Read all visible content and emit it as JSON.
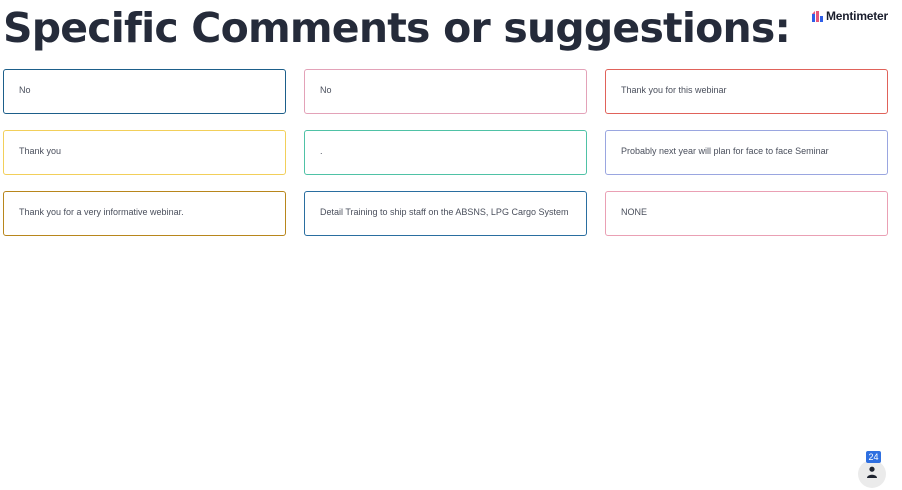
{
  "slide": {
    "title": "Specific Comments or suggestions:"
  },
  "brand": {
    "name": "Mentimeter",
    "logo_icon": "mentimeter-logo-icon"
  },
  "responses": [
    {
      "text": "No",
      "border_color": "#1d5f8a"
    },
    {
      "text": "No",
      "border_color": "#e3a2b8"
    },
    {
      "text": "Thank you for this webinar",
      "border_color": "#e0625a"
    },
    {
      "text": "Thank you",
      "border_color": "#f2cf5a"
    },
    {
      "text": ".",
      "border_color": "#4fc2a6"
    },
    {
      "text": "Probably next year will plan for face to face Seminar",
      "border_color": "#9aa6e0"
    },
    {
      "text": "Thank you for a very informative webinar.",
      "border_color": "#b8861c"
    },
    {
      "text": "Detail Training to ship staff on the ABSNS, LPG Cargo System",
      "border_color": "#2a6ea0"
    },
    {
      "text": "NONE",
      "border_color": "#eaa0b4"
    }
  ],
  "participants": {
    "count": "24",
    "icon": "person-icon",
    "badge_color": "#2e6fe0"
  }
}
